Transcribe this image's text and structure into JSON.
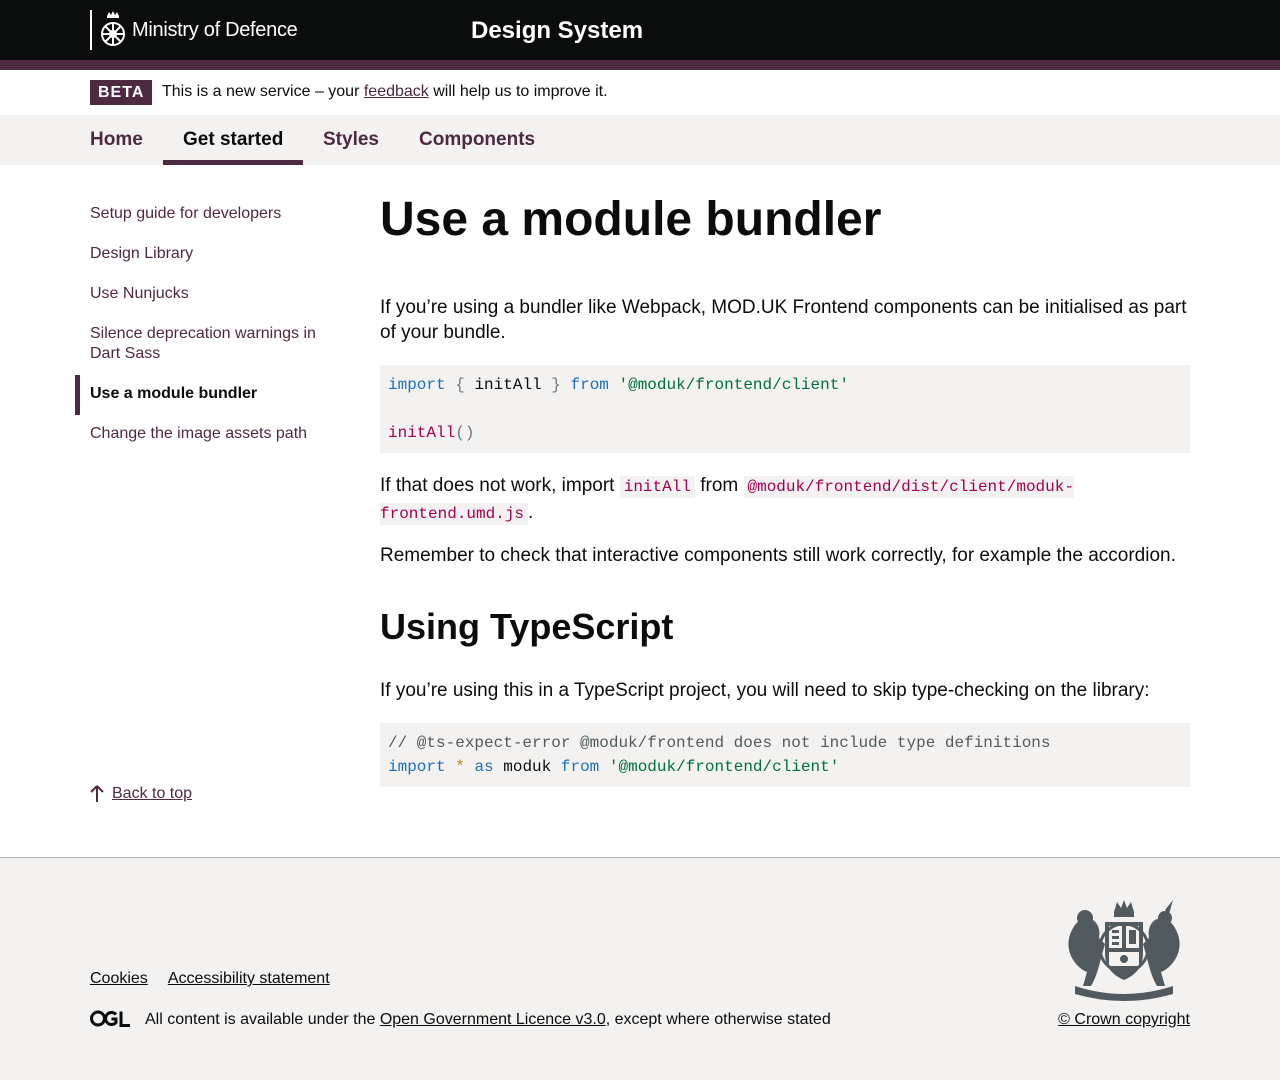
{
  "header": {
    "logo_text": "Ministry of Defence",
    "service_name": "Design System"
  },
  "phase_banner": {
    "tag": "BETA",
    "text_before": "This is a new service – your ",
    "link": "feedback",
    "text_after": " will help us to improve it."
  },
  "nav": {
    "items": [
      {
        "label": "Home"
      },
      {
        "label": "Get started"
      },
      {
        "label": "Styles"
      },
      {
        "label": "Components"
      }
    ],
    "active_index": 1
  },
  "sidebar": {
    "items": [
      {
        "label": "Setup guide for developers"
      },
      {
        "label": "Design Library"
      },
      {
        "label": "Use Nunjucks"
      },
      {
        "label": "Silence deprecation warnings in Dart Sass"
      },
      {
        "label": "Use a module bundler"
      },
      {
        "label": "Change the image assets path"
      }
    ],
    "current_index": 4,
    "back_to_top": "Back to top"
  },
  "main": {
    "title": "Use a module bundler",
    "intro": "If you’re using a bundler like Webpack, MOD.UK Frontend components can be initialised as part of your bundle.",
    "code1": {
      "kw_import": "import",
      "brace_open": "{",
      "ident": "initAll",
      "brace_close": "}",
      "kw_from": "from",
      "module": "'@moduk/frontend/client'",
      "call_fn": "initAll",
      "call_parens": "()"
    },
    "fallback": {
      "before": "If that does not work, import ",
      "code_a": "initAll",
      "middle": " from ",
      "code_b": "@moduk/frontend/dist/client/moduk-frontend.umd.js",
      "after": "."
    },
    "remember": "Remember to check that interactive components still work correctly, for example the accordion.",
    "h2": "Using TypeScript",
    "ts_para": "If you’re using this in a TypeScript project, you will need to skip type-checking on the library:",
    "code2": {
      "comment": "// @ts-expect-error @moduk/frontend does not include type definitions",
      "kw_import": "import",
      "star": "*",
      "kw_as": "as",
      "ident": "moduk",
      "kw_from": "from",
      "module": "'@moduk/frontend/client'"
    }
  },
  "footer": {
    "links": [
      {
        "label": "Cookies"
      },
      {
        "label": "Accessibility statement"
      }
    ],
    "licence_before": "All content is available under the ",
    "licence_link": "Open Government Licence v3.0",
    "licence_after": ", except where otherwise stated",
    "copyright": "© Crown copyright",
    "ogl_icon": "ogl-logo-icon",
    "crest_icon": "royal-coat-of-arms-icon"
  },
  "colors": {
    "brand": "#4d2942",
    "header_bg": "#0b0c0c",
    "light_bg": "#f3f2f1"
  }
}
